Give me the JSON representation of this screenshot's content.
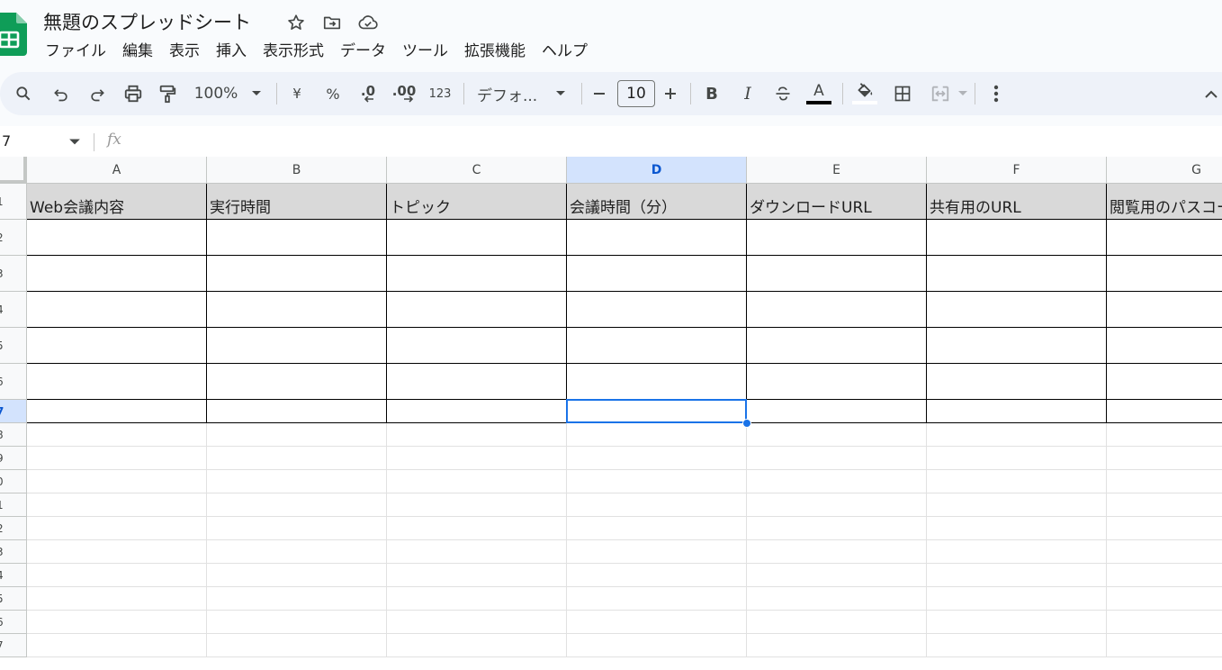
{
  "app": {
    "brand_color": "#0f9d58",
    "icon": "sheets-logo-icon"
  },
  "doc": {
    "title": "無題のスプレッドシート"
  },
  "menu": [
    "ファイル",
    "編集",
    "表示",
    "挿入",
    "表示形式",
    "データ",
    "ツール",
    "拡張機能",
    "ヘルプ"
  ],
  "toolbar": {
    "zoom": "100%",
    "currency": "¥",
    "percent": "%",
    "dec_decrease": ".0",
    "dec_increase": ".00",
    "number_format": "123",
    "font": "デフォ...",
    "font_size": "10",
    "bold": "B",
    "italic": "I",
    "text_color_letter": "A"
  },
  "formula_bar": {
    "cell_ref": "7",
    "fx": "fx",
    "value": ""
  },
  "columns": [
    "A",
    "B",
    "C",
    "D",
    "E",
    "F",
    "G"
  ],
  "selected_column": "D",
  "rows": [
    "1",
    "2",
    "3",
    "4",
    "5",
    "6",
    "7",
    "8",
    "9",
    "0",
    "1",
    "2",
    "3",
    "4",
    "5",
    "6",
    "7"
  ],
  "selected_row": "7",
  "header_row": [
    "Web会議内容",
    "実行時間",
    "トピック",
    "会議時間（分）",
    "ダウンロードURL",
    "共有用のURL",
    "閲覧用のパスコード"
  ],
  "colors": {
    "selection": "#1a73e8",
    "header_fill": "#d9d9d9",
    "toolbar_bg": "#eef2f9"
  }
}
